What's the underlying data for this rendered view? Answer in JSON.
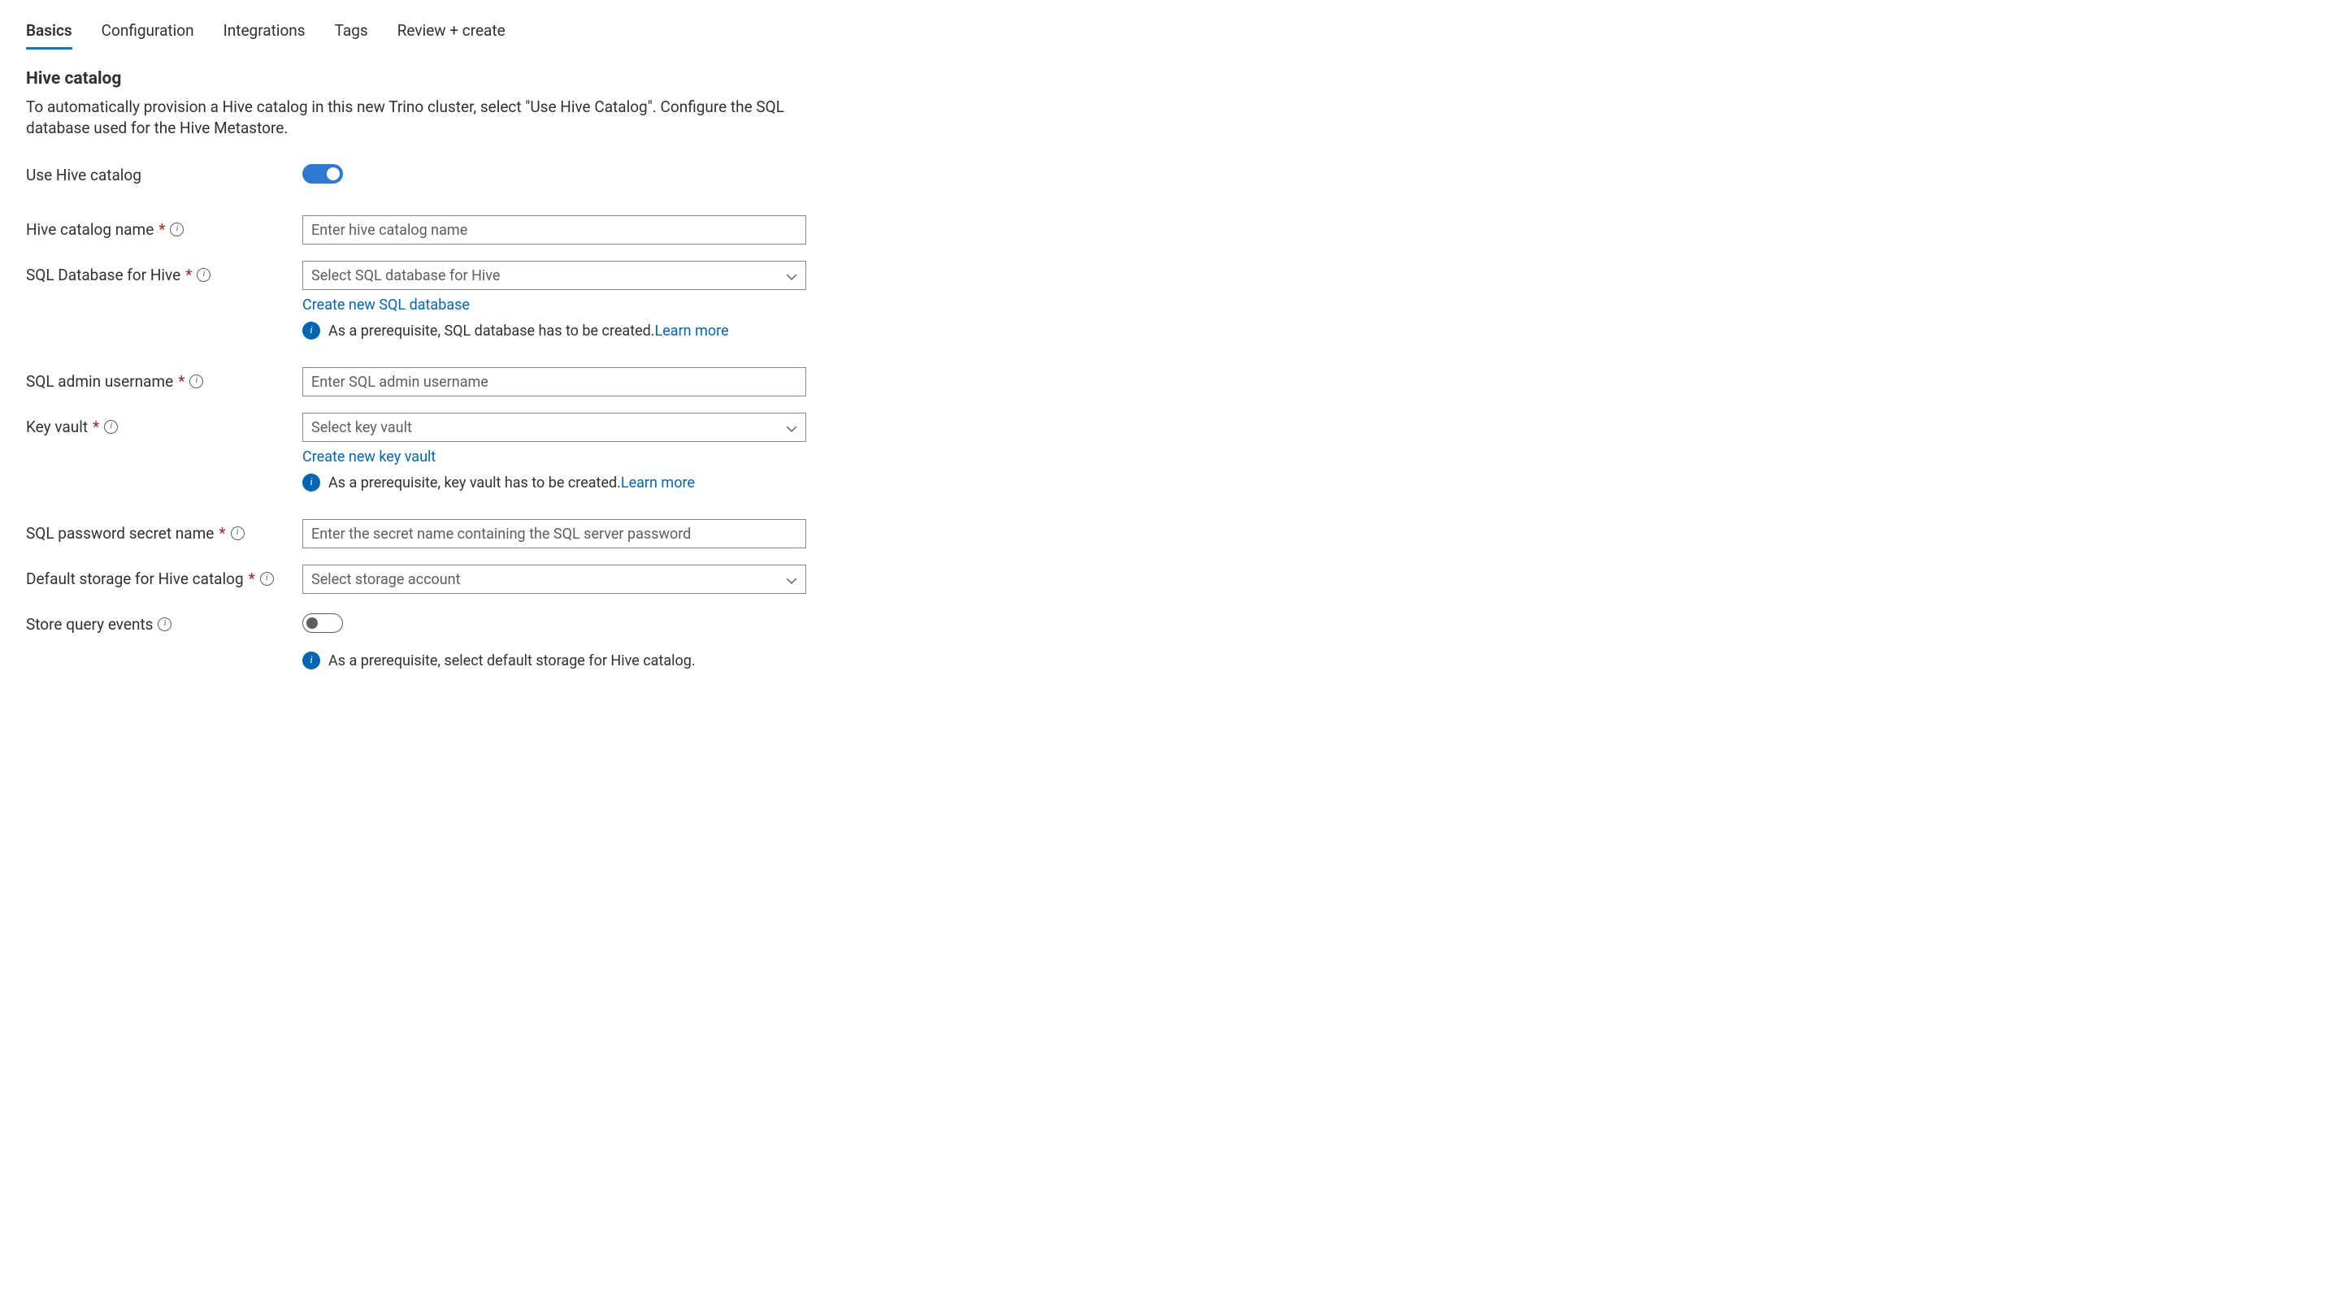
{
  "tabs": {
    "basics": "Basics",
    "configuration": "Configuration",
    "integrations": "Integrations",
    "tags": "Tags",
    "review": "Review + create"
  },
  "section": {
    "title": "Hive catalog",
    "description": "To automatically provision a Hive catalog in this new Trino cluster, select \"Use Hive Catalog\". Configure the SQL database used for the Hive Metastore."
  },
  "fields": {
    "useHiveCatalog": {
      "label": "Use Hive catalog"
    },
    "hiveCatalogName": {
      "label": "Hive catalog name",
      "placeholder": "Enter hive catalog name"
    },
    "sqlDatabase": {
      "label": "SQL Database for Hive",
      "placeholder": "Select SQL database for Hive",
      "createLink": "Create new SQL database",
      "prereqText": "As a prerequisite, SQL database has to be created.",
      "learnMore": "Learn more"
    },
    "sqlAdminUsername": {
      "label": "SQL admin username",
      "placeholder": "Enter SQL admin username"
    },
    "keyVault": {
      "label": "Key vault",
      "placeholder": "Select key vault",
      "createLink": "Create new key vault",
      "prereqText": "As a prerequisite, key vault has to be created.",
      "learnMore": "Learn more"
    },
    "sqlPasswordSecret": {
      "label": "SQL password secret name",
      "placeholder": "Enter the secret name containing the SQL server password"
    },
    "defaultStorage": {
      "label": "Default storage for Hive catalog",
      "placeholder": "Select storage account"
    },
    "storeQueryEvents": {
      "label": "Store query events",
      "prereqText": "As a prerequisite, select default storage for Hive catalog."
    }
  }
}
